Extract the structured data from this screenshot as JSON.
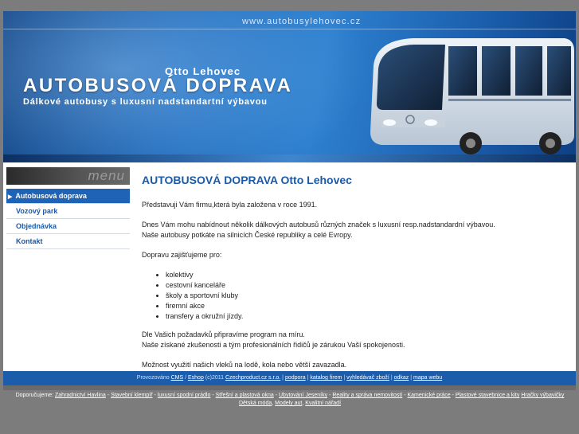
{
  "banner": {
    "url": "www.autobusylehovec.cz",
    "owner": "Otto Lehovec",
    "title": "AUTOBUSOVÁ DOPRAVA",
    "subtitle": "Dálkové autobusy s luxusní nadstandartní výbavou"
  },
  "menu": {
    "header": "menu",
    "items": [
      {
        "label": "Autobusová doprava",
        "active": true
      },
      {
        "label": "Vozový park"
      },
      {
        "label": "Objednávka"
      },
      {
        "label": "Kontakt"
      }
    ]
  },
  "content": {
    "heading": "AUTOBUSOVÁ DOPRAVA Otto Lehovec",
    "p1": "Představuji Vám firmu,která byla založena v roce 1991.",
    "p2a": "Dnes Vám mohu nabídnout několik dálkových autobusů různých značek s luxusní resp.nadstandardní výbavou.",
    "p2b": "Naše autobusy potkáte na silnicích České republiky a celé Evropy.",
    "p3": "Dopravu zajišťujeme pro:",
    "list": [
      "kolektivy",
      "cestovní kanceláře",
      "školy a sportovní kluby",
      "firemní akce",
      "transfery a okružní jízdy."
    ],
    "p4a": "Dle Vašich požadavků připravíme program na míru.",
    "p4b": "Naše získané zkušenosti a tým profesionálních řidičů je zárukou Vaší spokojenosti.",
    "p5": "Možnost využití našich vleků na lodě, kola nebo větší zavazadla."
  },
  "footer": {
    "prefix": "Provozováno",
    "cms": "CMS",
    "sep1": " / ",
    "eshop": "Eshop",
    "copyright": " (c)2011 ",
    "company": "Czechproduct.cz s.r.o.",
    "links": [
      "podpora",
      "katalog firem",
      "vyhledávač zboží",
      "odkaz",
      "mapa webu"
    ]
  },
  "recommend": {
    "label": "Doporučujeme:",
    "links": [
      "Zahradnictví Havlina",
      "Stavební klempíř",
      "luxusní spodní prádlo",
      "Střešní a plastová okna",
      "Ubytování Jeseníky",
      "Reality a správa nemovitostí",
      "Kamenické práce",
      "Plastové stavebnice a kity",
      "Hračky výbavičky",
      "Dětská móda",
      "Modely aut",
      "Kvalitní nářadí"
    ]
  }
}
